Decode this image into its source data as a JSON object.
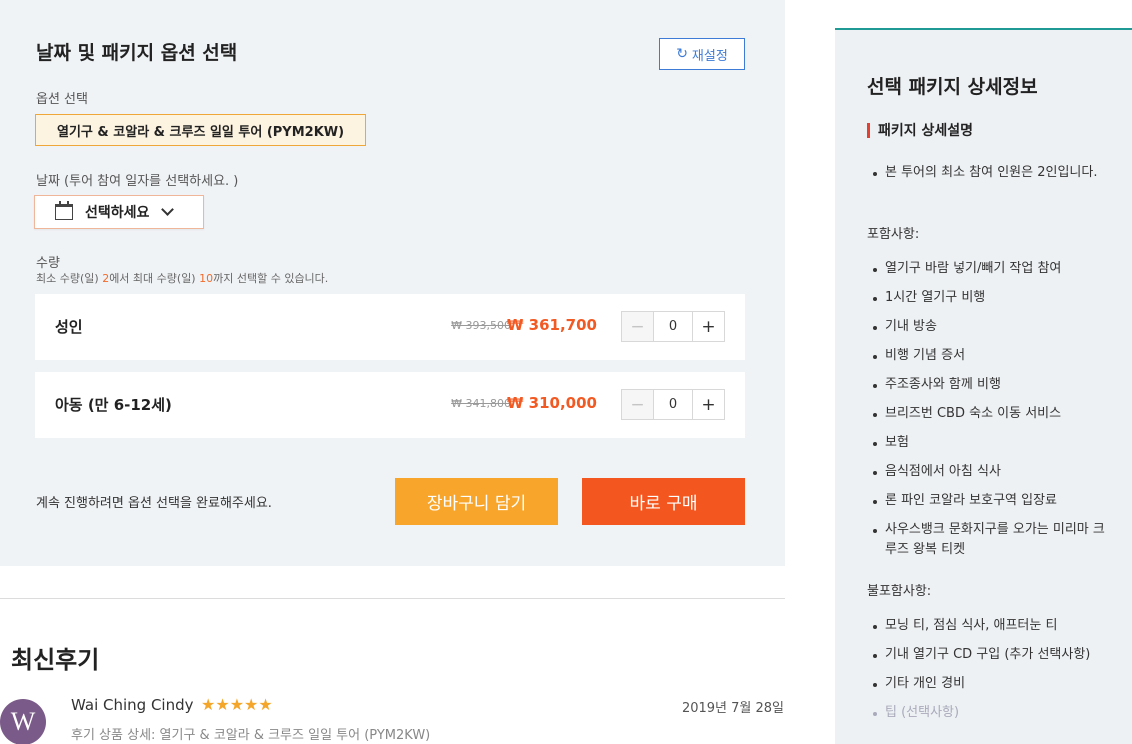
{
  "options": {
    "title": "날짜 및 패키지 옵션 선택",
    "reset_label": "재설정",
    "option_label": "옵션 선택",
    "package_chip": "열기구 & 코알라 & 크루즈 일일 투어 (PYM2KW)",
    "date_label": "날짜 (투어 참여 일자를 선택하세요. )",
    "date_placeholder": "선택하세요",
    "qty_label": "수량",
    "qty_note": {
      "pre": "최소 수량(일) ",
      "min": "2",
      "mid": "에서 최대 수량(일) ",
      "max": "10",
      "post": "까지 선택할 수 있습니다."
    },
    "tickets": [
      {
        "name": "성인",
        "original": "₩ 393,500",
        "price": "₩ 361,700",
        "qty": "0"
      },
      {
        "name": "아동 (만 6-12세)",
        "original": "₩ 341,800",
        "price": "₩ 310,000",
        "qty": "0"
      }
    ],
    "continue_note": "계속 진행하려면 옵션 선택을 완료해주세요.",
    "cart_label": "장바구니 담기",
    "buy_label": "바로 구매"
  },
  "reviews": {
    "title": "최신후기",
    "items": [
      {
        "avatar_letter": "W",
        "name": "Wai Ching Cindy",
        "stars": "★★★★★",
        "date": "2019년 7월 28일",
        "package": "후기 상품 상세: 열기구 & 코알라 & 크루즈 일일 투어 (PYM2KW)"
      }
    ]
  },
  "detail": {
    "title": "선택 패키지 상세정보",
    "section_title": "패키지 상세설명",
    "intro": [
      "본 투어의 최소 참여 인원은 2인입니다."
    ],
    "included_label": "포함사항:",
    "included": [
      "열기구 바람 넣기/빼기 작업 참여",
      "1시간 열기구 비행",
      "기내 방송",
      "비행 기념 증서",
      "주조종사와 함께 비행",
      "브리즈번 CBD 숙소 이동 서비스",
      "보험",
      "음식점에서 아침 식사",
      "론 파인 코알라 보호구역 입장료",
      "사우스뱅크 문화지구를 오가는 미리마 크루즈 왕복 티켓"
    ],
    "excluded_label": "불포함사항:",
    "excluded": [
      "모닝 티, 점심 식사, 애프터눈 티",
      "기내 열기구 CD 구입 (추가 선택사항)",
      "기타 개인 경비",
      "팁 (선택사항)"
    ]
  },
  "colors": {
    "accent_orange": "#f4561f",
    "cart_orange": "#f8a62b",
    "price_red": "#f25a23",
    "link_blue": "#3d7bd6",
    "teal": "#1f9a94"
  }
}
